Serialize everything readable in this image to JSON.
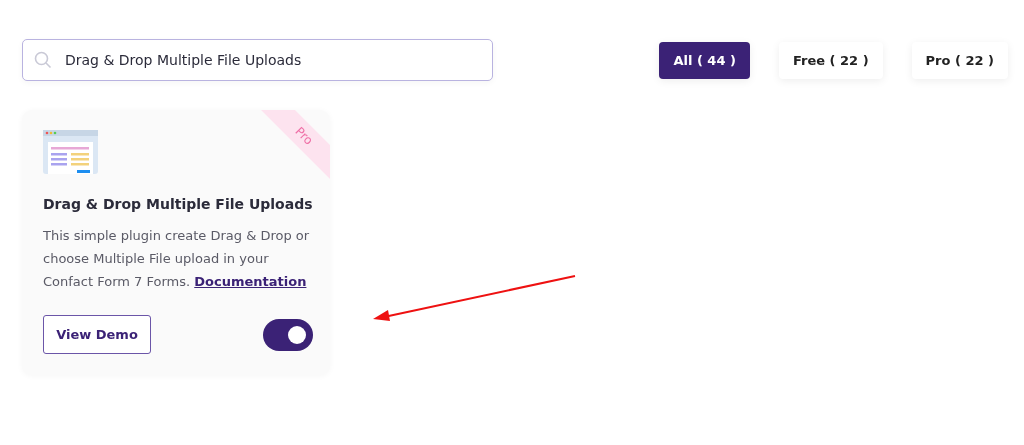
{
  "search": {
    "value": "Drag & Drop Multiple File Uploads"
  },
  "filters": [
    {
      "label": "All ( 44 )",
      "selected": true
    },
    {
      "label": "Free ( 22 )",
      "selected": false
    },
    {
      "label": "Pro ( 22 )",
      "selected": false
    }
  ],
  "cards": [
    {
      "ribbon": "Pro",
      "title": "Drag & Drop Multiple File Uploads",
      "description": "This simple plugin create Drag & Drop or choose Multiple File upload in your Confact Form 7 Forms.",
      "link": "Documentation",
      "button": "View Demo",
      "on": true
    }
  ]
}
